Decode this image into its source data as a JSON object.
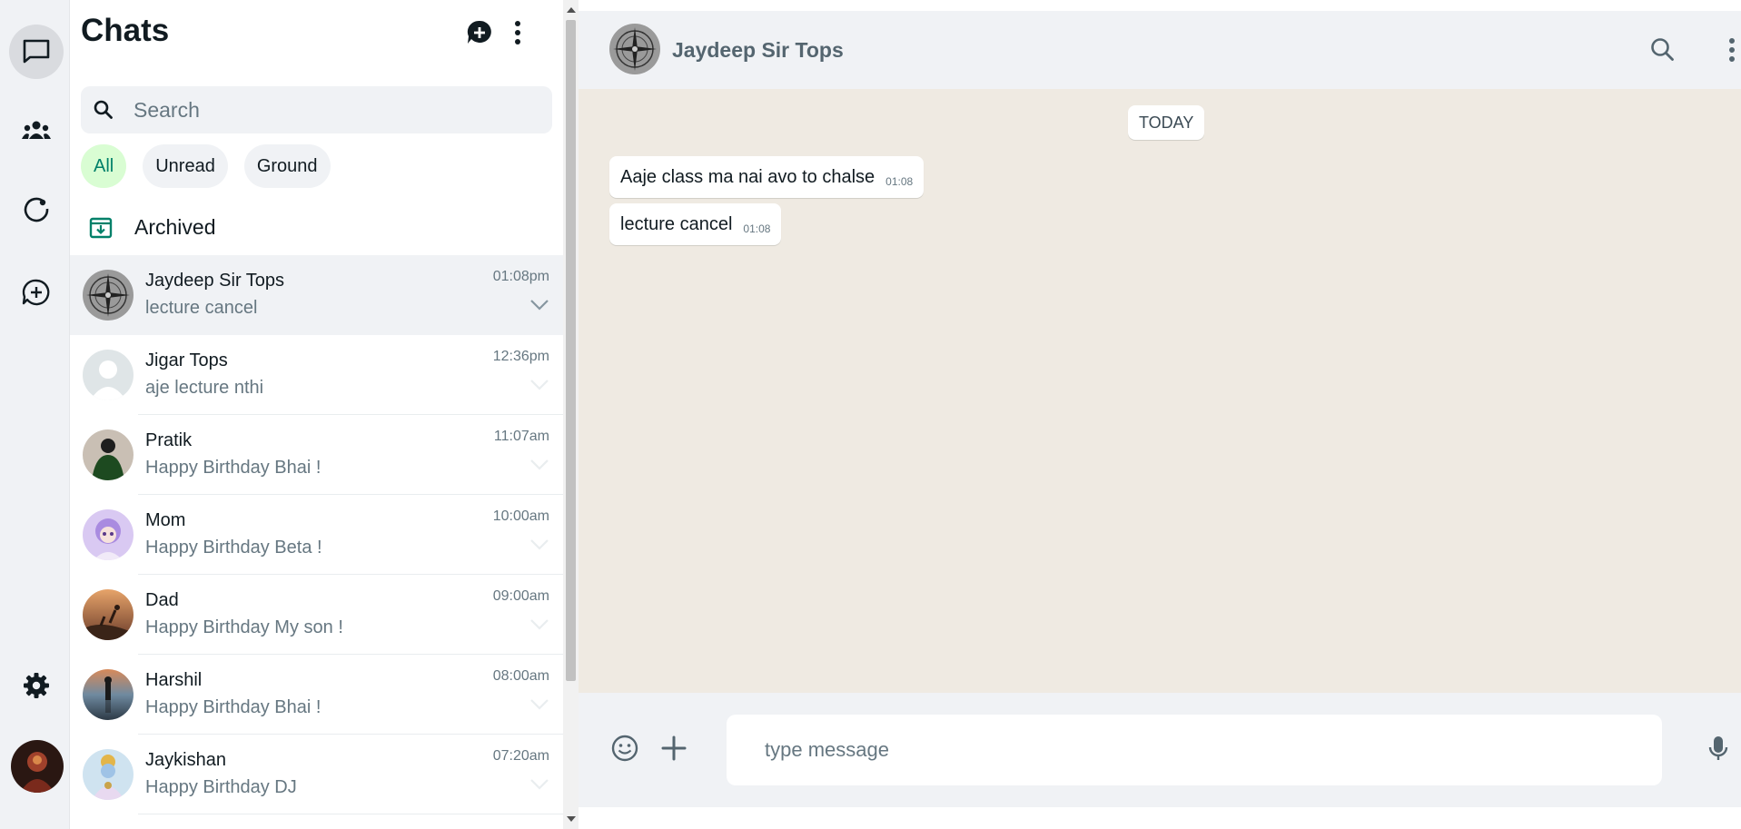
{
  "rail": {
    "items": [
      "chats-icon",
      "communities-icon",
      "status-icon",
      "channels-icon"
    ],
    "bottom": [
      "settings-icon",
      "profile-avatar"
    ]
  },
  "list": {
    "title": "Chats",
    "new_chat_icon": "new-chat-icon",
    "menu_icon": "menu-icon",
    "search_placeholder": "Search",
    "filters": [
      "All",
      "Unread",
      "Ground"
    ],
    "archived_label": "Archived",
    "chats": [
      {
        "name": "Jaydeep Sir Tops",
        "message": "lecture cancel",
        "time": "01:08pm",
        "selected": true,
        "avatar": "compass"
      },
      {
        "name": "Jigar Tops",
        "message": "aje lecture nthi",
        "time": "12:36pm",
        "avatar": "default"
      },
      {
        "name": "Pratik",
        "message": "Happy Birthday Bhai !",
        "time": "11:07am",
        "avatar": "pratik"
      },
      {
        "name": "Mom",
        "message": "Happy Birthday Beta !",
        "time": "10:00am",
        "avatar": "mom"
      },
      {
        "name": "Dad",
        "message": "Happy Birthday My son !",
        "time": "09:00am",
        "avatar": "dad"
      },
      {
        "name": "Harshil",
        "message": "Happy Birthday Bhai !",
        "time": "08:00am",
        "avatar": "harshil"
      },
      {
        "name": "Jaykishan",
        "message": "Happy Birthday DJ",
        "time": "07:20am",
        "avatar": "jaykishan"
      }
    ]
  },
  "conversation": {
    "name": "Jaydeep Sir Tops",
    "date_label": "TODAY",
    "messages": [
      {
        "text": "Aaje class ma nai avo to chalse",
        "time": "01:08"
      },
      {
        "text": "lecture cancel",
        "time": "01:08"
      }
    ],
    "composer_placeholder": "type message"
  },
  "colors": {
    "accent": "#008069",
    "chip_active_bg": "#d9fdd3",
    "chat_wallpaper": "#efeae2",
    "panel_bg": "#f0f2f5"
  }
}
